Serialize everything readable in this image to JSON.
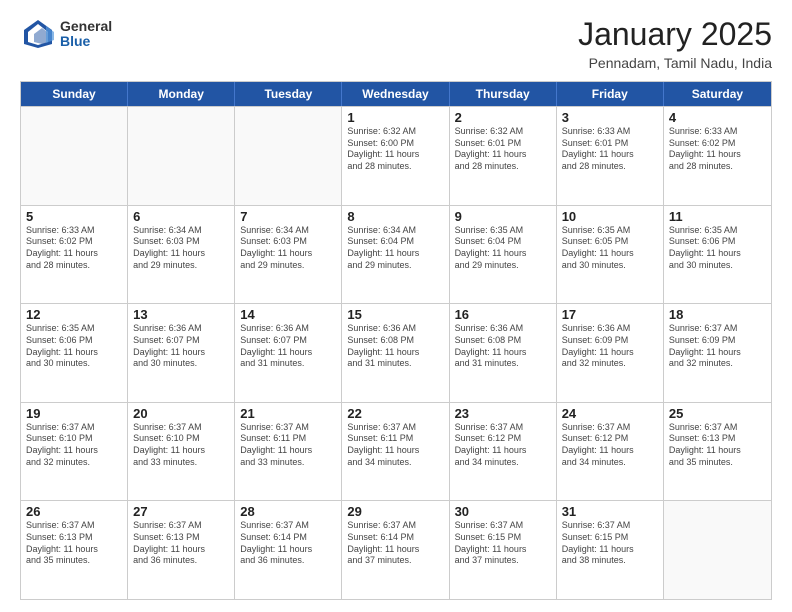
{
  "logo": {
    "general": "General",
    "blue": "Blue"
  },
  "title": "January 2025",
  "location": "Pennadam, Tamil Nadu, India",
  "header_days": [
    "Sunday",
    "Monday",
    "Tuesday",
    "Wednesday",
    "Thursday",
    "Friday",
    "Saturday"
  ],
  "weeks": [
    [
      {
        "day": "",
        "lines": []
      },
      {
        "day": "",
        "lines": []
      },
      {
        "day": "",
        "lines": []
      },
      {
        "day": "1",
        "lines": [
          "Sunrise: 6:32 AM",
          "Sunset: 6:00 PM",
          "Daylight: 11 hours",
          "and 28 minutes."
        ]
      },
      {
        "day": "2",
        "lines": [
          "Sunrise: 6:32 AM",
          "Sunset: 6:01 PM",
          "Daylight: 11 hours",
          "and 28 minutes."
        ]
      },
      {
        "day": "3",
        "lines": [
          "Sunrise: 6:33 AM",
          "Sunset: 6:01 PM",
          "Daylight: 11 hours",
          "and 28 minutes."
        ]
      },
      {
        "day": "4",
        "lines": [
          "Sunrise: 6:33 AM",
          "Sunset: 6:02 PM",
          "Daylight: 11 hours",
          "and 28 minutes."
        ]
      }
    ],
    [
      {
        "day": "5",
        "lines": [
          "Sunrise: 6:33 AM",
          "Sunset: 6:02 PM",
          "Daylight: 11 hours",
          "and 28 minutes."
        ]
      },
      {
        "day": "6",
        "lines": [
          "Sunrise: 6:34 AM",
          "Sunset: 6:03 PM",
          "Daylight: 11 hours",
          "and 29 minutes."
        ]
      },
      {
        "day": "7",
        "lines": [
          "Sunrise: 6:34 AM",
          "Sunset: 6:03 PM",
          "Daylight: 11 hours",
          "and 29 minutes."
        ]
      },
      {
        "day": "8",
        "lines": [
          "Sunrise: 6:34 AM",
          "Sunset: 6:04 PM",
          "Daylight: 11 hours",
          "and 29 minutes."
        ]
      },
      {
        "day": "9",
        "lines": [
          "Sunrise: 6:35 AM",
          "Sunset: 6:04 PM",
          "Daylight: 11 hours",
          "and 29 minutes."
        ]
      },
      {
        "day": "10",
        "lines": [
          "Sunrise: 6:35 AM",
          "Sunset: 6:05 PM",
          "Daylight: 11 hours",
          "and 30 minutes."
        ]
      },
      {
        "day": "11",
        "lines": [
          "Sunrise: 6:35 AM",
          "Sunset: 6:06 PM",
          "Daylight: 11 hours",
          "and 30 minutes."
        ]
      }
    ],
    [
      {
        "day": "12",
        "lines": [
          "Sunrise: 6:35 AM",
          "Sunset: 6:06 PM",
          "Daylight: 11 hours",
          "and 30 minutes."
        ]
      },
      {
        "day": "13",
        "lines": [
          "Sunrise: 6:36 AM",
          "Sunset: 6:07 PM",
          "Daylight: 11 hours",
          "and 30 minutes."
        ]
      },
      {
        "day": "14",
        "lines": [
          "Sunrise: 6:36 AM",
          "Sunset: 6:07 PM",
          "Daylight: 11 hours",
          "and 31 minutes."
        ]
      },
      {
        "day": "15",
        "lines": [
          "Sunrise: 6:36 AM",
          "Sunset: 6:08 PM",
          "Daylight: 11 hours",
          "and 31 minutes."
        ]
      },
      {
        "day": "16",
        "lines": [
          "Sunrise: 6:36 AM",
          "Sunset: 6:08 PM",
          "Daylight: 11 hours",
          "and 31 minutes."
        ]
      },
      {
        "day": "17",
        "lines": [
          "Sunrise: 6:36 AM",
          "Sunset: 6:09 PM",
          "Daylight: 11 hours",
          "and 32 minutes."
        ]
      },
      {
        "day": "18",
        "lines": [
          "Sunrise: 6:37 AM",
          "Sunset: 6:09 PM",
          "Daylight: 11 hours",
          "and 32 minutes."
        ]
      }
    ],
    [
      {
        "day": "19",
        "lines": [
          "Sunrise: 6:37 AM",
          "Sunset: 6:10 PM",
          "Daylight: 11 hours",
          "and 32 minutes."
        ]
      },
      {
        "day": "20",
        "lines": [
          "Sunrise: 6:37 AM",
          "Sunset: 6:10 PM",
          "Daylight: 11 hours",
          "and 33 minutes."
        ]
      },
      {
        "day": "21",
        "lines": [
          "Sunrise: 6:37 AM",
          "Sunset: 6:11 PM",
          "Daylight: 11 hours",
          "and 33 minutes."
        ]
      },
      {
        "day": "22",
        "lines": [
          "Sunrise: 6:37 AM",
          "Sunset: 6:11 PM",
          "Daylight: 11 hours",
          "and 34 minutes."
        ]
      },
      {
        "day": "23",
        "lines": [
          "Sunrise: 6:37 AM",
          "Sunset: 6:12 PM",
          "Daylight: 11 hours",
          "and 34 minutes."
        ]
      },
      {
        "day": "24",
        "lines": [
          "Sunrise: 6:37 AM",
          "Sunset: 6:12 PM",
          "Daylight: 11 hours",
          "and 34 minutes."
        ]
      },
      {
        "day": "25",
        "lines": [
          "Sunrise: 6:37 AM",
          "Sunset: 6:13 PM",
          "Daylight: 11 hours",
          "and 35 minutes."
        ]
      }
    ],
    [
      {
        "day": "26",
        "lines": [
          "Sunrise: 6:37 AM",
          "Sunset: 6:13 PM",
          "Daylight: 11 hours",
          "and 35 minutes."
        ]
      },
      {
        "day": "27",
        "lines": [
          "Sunrise: 6:37 AM",
          "Sunset: 6:13 PM",
          "Daylight: 11 hours",
          "and 36 minutes."
        ]
      },
      {
        "day": "28",
        "lines": [
          "Sunrise: 6:37 AM",
          "Sunset: 6:14 PM",
          "Daylight: 11 hours",
          "and 36 minutes."
        ]
      },
      {
        "day": "29",
        "lines": [
          "Sunrise: 6:37 AM",
          "Sunset: 6:14 PM",
          "Daylight: 11 hours",
          "and 37 minutes."
        ]
      },
      {
        "day": "30",
        "lines": [
          "Sunrise: 6:37 AM",
          "Sunset: 6:15 PM",
          "Daylight: 11 hours",
          "and 37 minutes."
        ]
      },
      {
        "day": "31",
        "lines": [
          "Sunrise: 6:37 AM",
          "Sunset: 6:15 PM",
          "Daylight: 11 hours",
          "and 38 minutes."
        ]
      },
      {
        "day": "",
        "lines": []
      }
    ]
  ]
}
